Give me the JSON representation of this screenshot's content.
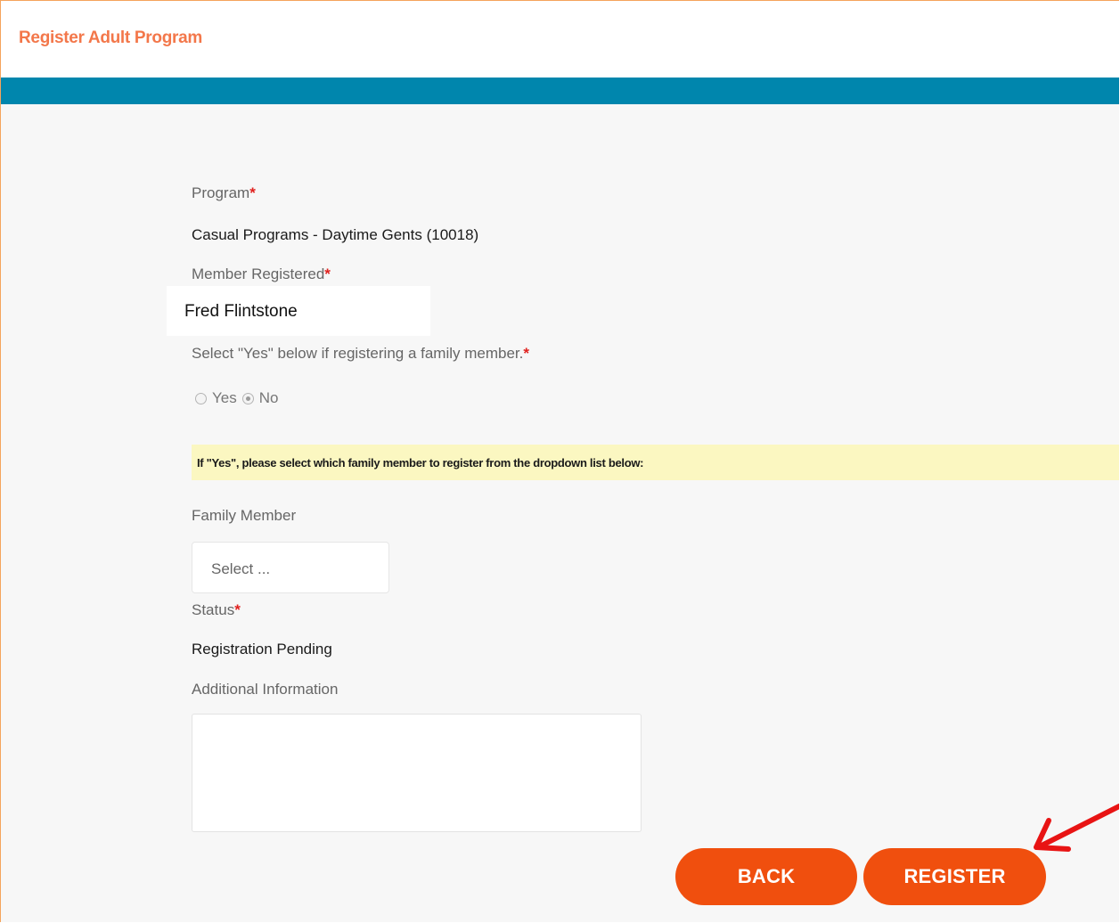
{
  "header": {
    "title": "Register Adult Program"
  },
  "form": {
    "program": {
      "label": "Program",
      "required_mark": "*",
      "value": "Casual Programs - Daytime Gents (10018)"
    },
    "member": {
      "label": "Member Registered",
      "required_mark": "*",
      "value": "Fred Flintstone"
    },
    "family_question": {
      "label": "Select \"Yes\" below if registering a family member.",
      "required_mark": "*",
      "options": [
        {
          "label": "Yes",
          "selected": false
        },
        {
          "label": "No",
          "selected": true
        }
      ]
    },
    "note": "If \"Yes\", please select which family member to register from the dropdown list below:",
    "family_member": {
      "label": "Family Member",
      "placeholder": "Select ..."
    },
    "status": {
      "label": "Status",
      "required_mark": "*",
      "value": "Registration Pending"
    },
    "additional_info": {
      "label": "Additional Information",
      "value": ""
    }
  },
  "buttons": {
    "back": "BACK",
    "register": "REGISTER"
  },
  "colors": {
    "header_title": "#f3774a",
    "teal_bar": "#0086ad",
    "button": "#f04f0e",
    "required": "#e0211e",
    "note_bg": "#fbf7c1",
    "annotation_arrow": "#e81414"
  }
}
